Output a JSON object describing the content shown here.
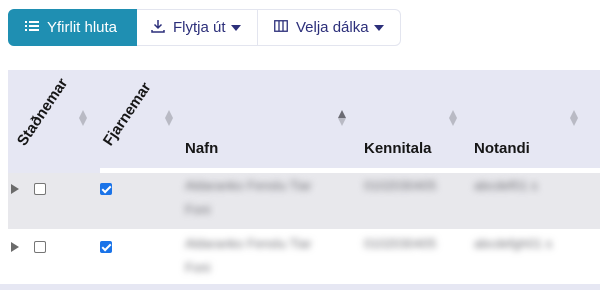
{
  "toolbar": {
    "overview_label": "Yfirlit hluta",
    "export_label": "Flytja út",
    "columns_label": "Velja dálka",
    "accent": "#1f8fb2"
  },
  "table": {
    "headers": {
      "stadnemar": "Staðnemar",
      "fjarnemar": "Fjarnemar",
      "nafn": "Nafn",
      "kennitala": "Kennitala",
      "notandi": "Notandi"
    },
    "rows": [
      {
        "stadnemar": false,
        "fjarnemar": true,
        "nafn_line1": "Aldaranko Fenslu Tiar",
        "nafn_line2": "Foni",
        "kennitala": "0102030405",
        "notandi": "abcdef01 s"
      },
      {
        "stadnemar": false,
        "fjarnemar": true,
        "nafn_line1": "Aldaranko Fenslu Tiar",
        "nafn_line2": "Foni",
        "kennitala": "0102030405",
        "notandi": "abcdefgh01 s"
      }
    ]
  }
}
